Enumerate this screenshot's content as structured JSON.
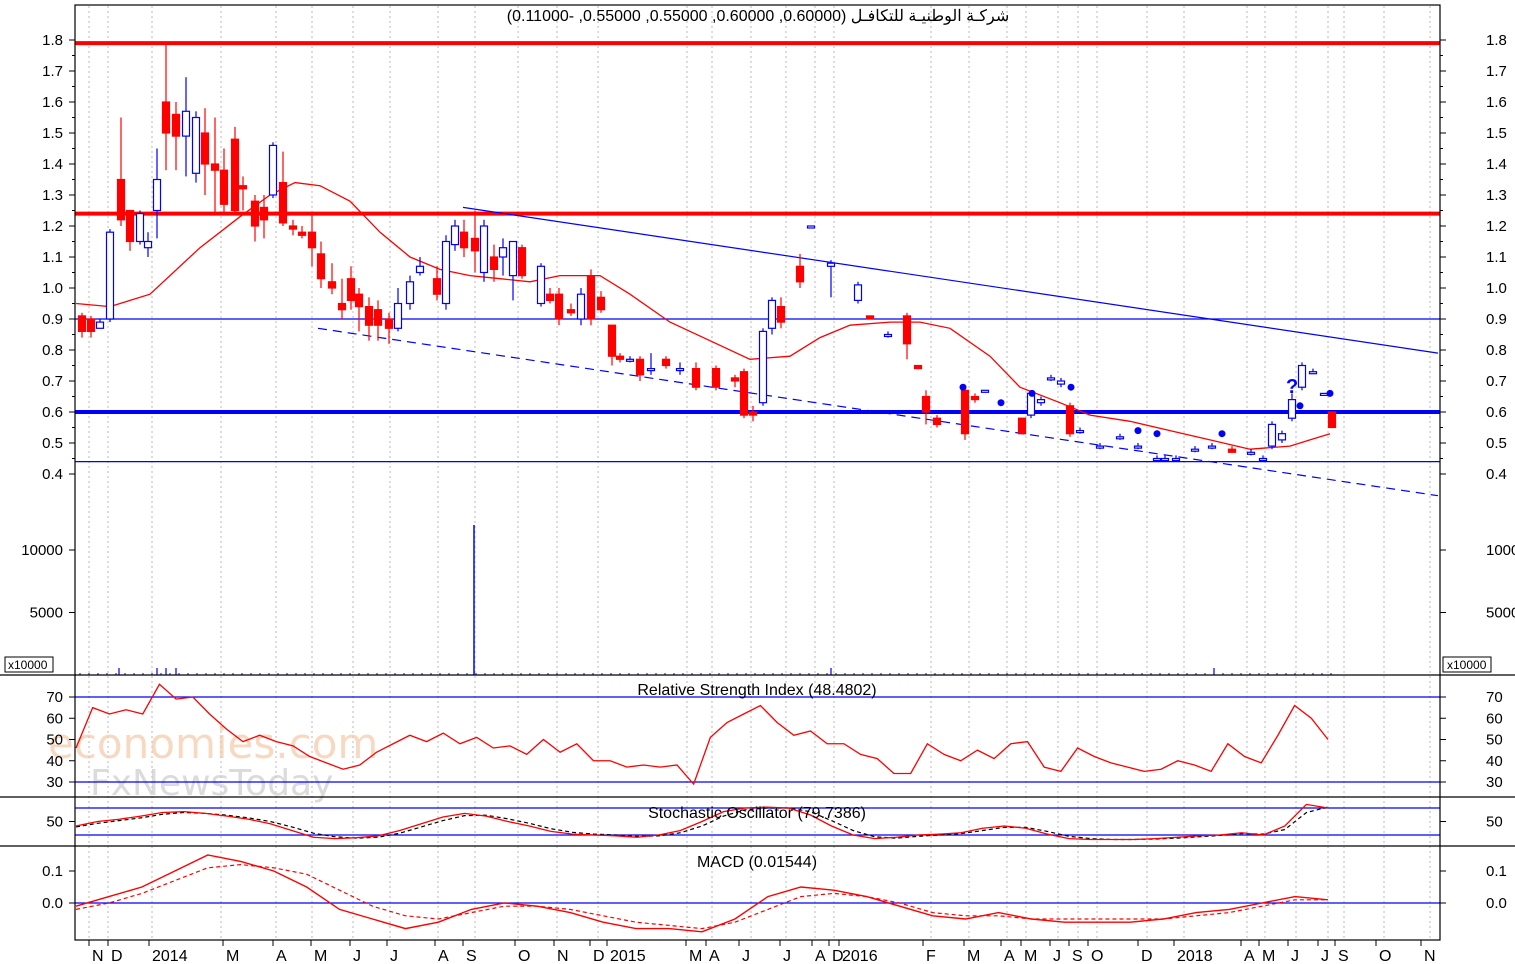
{
  "chart_data": {
    "type": "candlestick",
    "title": "شركـة الوطنيـة للتكافـل (0.60000, 0.60000, 0.55000, 0.55000, -0.11000)",
    "watermark": [
      "economies.com",
      "FxNewsToday"
    ],
    "x_labels": [
      "N",
      "D",
      "2014",
      "M",
      "A",
      "M",
      "J",
      "J",
      "A",
      "S",
      "O",
      "N",
      "D",
      "2015",
      "M",
      "A",
      "J",
      "J",
      "A",
      "D",
      "2016",
      "F",
      "M",
      "A",
      "M",
      "J",
      "S",
      "O",
      "D",
      "2018",
      "A",
      "M",
      "J",
      "J",
      "S",
      "O",
      "N"
    ],
    "price_panel": {
      "y_ticks": [
        0.4,
        0.5,
        0.6,
        0.7,
        0.8,
        0.9,
        1.0,
        1.1,
        1.2,
        1.3,
        1.4,
        1.5,
        1.6,
        1.7,
        1.8
      ],
      "ylim": [
        0.4,
        1.8
      ],
      "horizontal_levels": [
        {
          "value": 1.79,
          "color": "#ff0000",
          "style": "thick"
        },
        {
          "value": 1.24,
          "color": "#ff0000",
          "style": "thick"
        },
        {
          "value": 0.6,
          "color": "#0000ff",
          "style": "thick"
        },
        {
          "value": 0.9,
          "color": "#0000ff",
          "style": "thin"
        },
        {
          "value": 0.44,
          "color": "#0000ff",
          "style": "thin"
        }
      ],
      "trendlines": [
        {
          "from": [
            "2014-08",
            1.26
          ],
          "to": [
            "2018-11",
            0.79
          ],
          "color": "#0000ff",
          "style": "solid"
        },
        {
          "from": [
            "2014-04",
            0.87
          ],
          "to": [
            "2018-11",
            0.33
          ],
          "color": "#0000ff",
          "style": "dashed"
        }
      ],
      "moving_average_color": "#ff0000",
      "up_color": "#0000ff",
      "down_color": "#ff0000"
    },
    "volume_panel": {
      "y_ticks": [
        5000,
        10000
      ],
      "unit_label": "x10000",
      "spike": {
        "period": "2014-08",
        "value": 12000
      }
    },
    "rsi_panel": {
      "title": "Relative Strength Index (48.4802)",
      "y_ticks": [
        30,
        40,
        50,
        60,
        70
      ],
      "levels": [
        70,
        30
      ],
      "series": [
        [
          0,
          46
        ],
        [
          1,
          65
        ],
        [
          2,
          62
        ],
        [
          3,
          64
        ],
        [
          4,
          62
        ],
        [
          5,
          76
        ],
        [
          6,
          69
        ],
        [
          7,
          70
        ],
        [
          8,
          62
        ],
        [
          9,
          55
        ],
        [
          10,
          49
        ],
        [
          11,
          52
        ],
        [
          12,
          49
        ],
        [
          13,
          47
        ],
        [
          14,
          42
        ],
        [
          15,
          39
        ],
        [
          16,
          36
        ],
        [
          17,
          38
        ],
        [
          18,
          44
        ],
        [
          19,
          48
        ],
        [
          20,
          52
        ],
        [
          21,
          49
        ],
        [
          22,
          53
        ],
        [
          23,
          48
        ],
        [
          24,
          51
        ],
        [
          25,
          46
        ],
        [
          26,
          47
        ],
        [
          27,
          43
        ],
        [
          28,
          50
        ],
        [
          29,
          44
        ],
        [
          30,
          48
        ],
        [
          31,
          40
        ],
        [
          32,
          40
        ],
        [
          33,
          37
        ],
        [
          34,
          38
        ],
        [
          35,
          37
        ],
        [
          36,
          38
        ],
        [
          37,
          29
        ],
        [
          38,
          51
        ],
        [
          39,
          58
        ],
        [
          40,
          62
        ],
        [
          41,
          66
        ],
        [
          42,
          58
        ],
        [
          43,
          52
        ],
        [
          44,
          54
        ],
        [
          45,
          48
        ],
        [
          46,
          48
        ],
        [
          47,
          43
        ],
        [
          48,
          41
        ],
        [
          49,
          34
        ],
        [
          50,
          34
        ],
        [
          51,
          48
        ],
        [
          52,
          43
        ],
        [
          53,
          40
        ],
        [
          54,
          45
        ],
        [
          55,
          41
        ],
        [
          56,
          48
        ],
        [
          57,
          49
        ],
        [
          58,
          37
        ],
        [
          59,
          35
        ],
        [
          60,
          46
        ],
        [
          61,
          42
        ],
        [
          62,
          39
        ],
        [
          63,
          37
        ],
        [
          64,
          35
        ],
        [
          65,
          36
        ],
        [
          66,
          40
        ],
        [
          67,
          38
        ],
        [
          68,
          35
        ],
        [
          69,
          48
        ],
        [
          70,
          42
        ],
        [
          71,
          39
        ],
        [
          72,
          52
        ],
        [
          73,
          66
        ],
        [
          74,
          60
        ],
        [
          75,
          50
        ]
      ]
    },
    "stochastic_panel": {
      "title": "Stochastic Oscillator (79.7386)",
      "y_ticks": [
        50
      ],
      "levels": [
        80,
        20
      ],
      "k_series": [
        [
          0,
          40
        ],
        [
          1,
          50
        ],
        [
          2,
          55
        ],
        [
          3,
          62
        ],
        [
          4,
          70
        ],
        [
          5,
          72
        ],
        [
          6,
          68
        ],
        [
          7,
          62
        ],
        [
          8,
          55
        ],
        [
          9,
          45
        ],
        [
          10,
          30
        ],
        [
          11,
          15
        ],
        [
          12,
          12
        ],
        [
          13,
          14
        ],
        [
          14,
          18
        ],
        [
          15,
          30
        ],
        [
          16,
          45
        ],
        [
          17,
          60
        ],
        [
          18,
          68
        ],
        [
          19,
          62
        ],
        [
          20,
          50
        ],
        [
          21,
          40
        ],
        [
          22,
          28
        ],
        [
          23,
          22
        ],
        [
          24,
          20
        ],
        [
          25,
          18
        ],
        [
          26,
          15
        ],
        [
          27,
          20
        ],
        [
          28,
          30
        ],
        [
          29,
          50
        ],
        [
          30,
          72
        ],
        [
          31,
          80
        ],
        [
          32,
          82
        ],
        [
          33,
          80
        ],
        [
          34,
          65
        ],
        [
          35,
          40
        ],
        [
          36,
          20
        ],
        [
          37,
          12
        ],
        [
          38,
          15
        ],
        [
          39,
          20
        ],
        [
          40,
          22
        ],
        [
          41,
          25
        ],
        [
          42,
          35
        ],
        [
          43,
          40
        ],
        [
          44,
          35
        ],
        [
          45,
          22
        ],
        [
          46,
          12
        ],
        [
          47,
          10
        ],
        [
          48,
          10
        ],
        [
          49,
          10
        ],
        [
          50,
          12
        ],
        [
          51,
          15
        ],
        [
          52,
          18
        ],
        [
          53,
          20
        ],
        [
          54,
          25
        ],
        [
          55,
          20
        ],
        [
          56,
          40
        ],
        [
          57,
          88
        ],
        [
          58,
          80
        ]
      ],
      "d_series": [
        [
          0,
          38
        ],
        [
          1,
          46
        ],
        [
          2,
          52
        ],
        [
          3,
          58
        ],
        [
          4,
          66
        ],
        [
          5,
          70
        ],
        [
          6,
          68
        ],
        [
          7,
          64
        ],
        [
          8,
          58
        ],
        [
          9,
          50
        ],
        [
          10,
          38
        ],
        [
          11,
          24
        ],
        [
          12,
          16
        ],
        [
          13,
          13
        ],
        [
          14,
          15
        ],
        [
          15,
          24
        ],
        [
          16,
          38
        ],
        [
          17,
          52
        ],
        [
          18,
          63
        ],
        [
          19,
          64
        ],
        [
          20,
          56
        ],
        [
          21,
          46
        ],
        [
          22,
          34
        ],
        [
          23,
          26
        ],
        [
          24,
          22
        ],
        [
          25,
          20
        ],
        [
          26,
          17
        ],
        [
          27,
          18
        ],
        [
          28,
          25
        ],
        [
          29,
          40
        ],
        [
          30,
          62
        ],
        [
          31,
          76
        ],
        [
          32,
          80
        ],
        [
          33,
          80
        ],
        [
          34,
          72
        ],
        [
          35,
          52
        ],
        [
          36,
          30
        ],
        [
          37,
          16
        ],
        [
          38,
          13
        ],
        [
          39,
          17
        ],
        [
          40,
          20
        ],
        [
          41,
          23
        ],
        [
          42,
          30
        ],
        [
          43,
          37
        ],
        [
          44,
          37
        ],
        [
          45,
          28
        ],
        [
          46,
          17
        ],
        [
          47,
          12
        ],
        [
          48,
          10
        ],
        [
          49,
          10
        ],
        [
          50,
          11
        ],
        [
          51,
          13
        ],
        [
          52,
          16
        ],
        [
          53,
          19
        ],
        [
          54,
          23
        ],
        [
          55,
          22
        ],
        [
          56,
          32
        ],
        [
          57,
          70
        ],
        [
          58,
          82
        ]
      ]
    },
    "macd_panel": {
      "title": "MACD (0.01544)",
      "y_ticks": [
        0.0,
        0.1
      ],
      "ylim": [
        -0.09,
        0.16
      ],
      "macd_series": [
        [
          0,
          -0.01
        ],
        [
          1,
          0.02
        ],
        [
          2,
          0.05
        ],
        [
          3,
          0.1
        ],
        [
          4,
          0.15
        ],
        [
          5,
          0.13
        ],
        [
          6,
          0.1
        ],
        [
          7,
          0.05
        ],
        [
          8,
          -0.02
        ],
        [
          9,
          -0.05
        ],
        [
          10,
          -0.08
        ],
        [
          11,
          -0.06
        ],
        [
          12,
          -0.02
        ],
        [
          13,
          0.0
        ],
        [
          14,
          -0.01
        ],
        [
          15,
          -0.03
        ],
        [
          16,
          -0.06
        ],
        [
          17,
          -0.08
        ],
        [
          18,
          -0.08
        ],
        [
          19,
          -0.09
        ],
        [
          20,
          -0.05
        ],
        [
          21,
          0.02
        ],
        [
          22,
          0.05
        ],
        [
          23,
          0.04
        ],
        [
          24,
          0.02
        ],
        [
          25,
          -0.01
        ],
        [
          26,
          -0.04
        ],
        [
          27,
          -0.05
        ],
        [
          28,
          -0.03
        ],
        [
          29,
          -0.05
        ],
        [
          30,
          -0.06
        ],
        [
          31,
          -0.06
        ],
        [
          32,
          -0.06
        ],
        [
          33,
          -0.05
        ],
        [
          34,
          -0.03
        ],
        [
          35,
          -0.02
        ],
        [
          36,
          0.0
        ],
        [
          37,
          0.02
        ],
        [
          38,
          0.01
        ]
      ],
      "signal_series": [
        [
          0,
          -0.02
        ],
        [
          1,
          0.0
        ],
        [
          2,
          0.03
        ],
        [
          3,
          0.07
        ],
        [
          4,
          0.11
        ],
        [
          5,
          0.12
        ],
        [
          6,
          0.11
        ],
        [
          7,
          0.09
        ],
        [
          8,
          0.04
        ],
        [
          9,
          -0.01
        ],
        [
          10,
          -0.04
        ],
        [
          11,
          -0.05
        ],
        [
          12,
          -0.03
        ],
        [
          13,
          -0.01
        ],
        [
          14,
          -0.01
        ],
        [
          15,
          -0.02
        ],
        [
          16,
          -0.04
        ],
        [
          17,
          -0.06
        ],
        [
          18,
          -0.07
        ],
        [
          19,
          -0.08
        ],
        [
          20,
          -0.06
        ],
        [
          21,
          -0.02
        ],
        [
          22,
          0.02
        ],
        [
          23,
          0.03
        ],
        [
          24,
          0.02
        ],
        [
          25,
          0.0
        ],
        [
          26,
          -0.03
        ],
        [
          27,
          -0.04
        ],
        [
          28,
          -0.04
        ],
        [
          29,
          -0.05
        ],
        [
          30,
          -0.05
        ],
        [
          31,
          -0.05
        ],
        [
          32,
          -0.05
        ],
        [
          33,
          -0.05
        ],
        [
          34,
          -0.04
        ],
        [
          35,
          -0.03
        ],
        [
          36,
          -0.01
        ],
        [
          37,
          0.01
        ],
        [
          38,
          0.01
        ]
      ],
      "zero_line_color": "#0000ff"
    }
  }
}
